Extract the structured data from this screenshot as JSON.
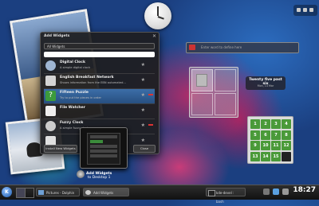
{
  "dialog": {
    "title": "Add Widgets",
    "close": "✕",
    "filter": "All Widgets",
    "widgets": [
      {
        "name": "Digital Clock",
        "desc": "A simple digital clock",
        "icon_color": "#9fb6d3"
      },
      {
        "name": "English Breakfast Network",
        "desc": "Shows information from the EBN automated…",
        "icon_color": "#d4d4d4"
      },
      {
        "name": "Fifteen Puzzle",
        "desc": "Try to put the pieces in order",
        "icon_color": "#3c9b3c"
      },
      {
        "name": "File Watcher",
        "desc": "",
        "icon_color": "#eeeeee"
      },
      {
        "name": "Fuzzy Clock",
        "desc": "A simple fuzzy clock",
        "icon_color": "#cccccc"
      },
      {
        "name": "",
        "desc": "",
        "icon_color": "#e0e0e0"
      }
    ],
    "buttons": {
      "install": "Install New Widgets",
      "add": "Add Widget",
      "close": "Close"
    }
  },
  "zoom": {
    "label_line1": "Add Widgets",
    "label_line2": "to Desktop 1"
  },
  "search": {
    "placeholder": "Enter word to define here"
  },
  "fuzzy_clock": {
    "line1": "Twenty five past six",
    "line2": "Mon, 14 Mar"
  },
  "puzzle": {
    "tiles": [
      "1",
      "2",
      "3",
      "4",
      "5",
      "6",
      "7",
      "8",
      "9",
      "10",
      "11",
      "12",
      "13",
      "14",
      "15",
      ""
    ]
  },
  "panel": {
    "kmenu": "K",
    "tasks": [
      {
        "label": "Pictures - Dolphin"
      },
      {
        "label": "Add Widgets"
      },
      {
        "label": "kde-devel : bash"
      }
    ],
    "clock": "18:27"
  }
}
